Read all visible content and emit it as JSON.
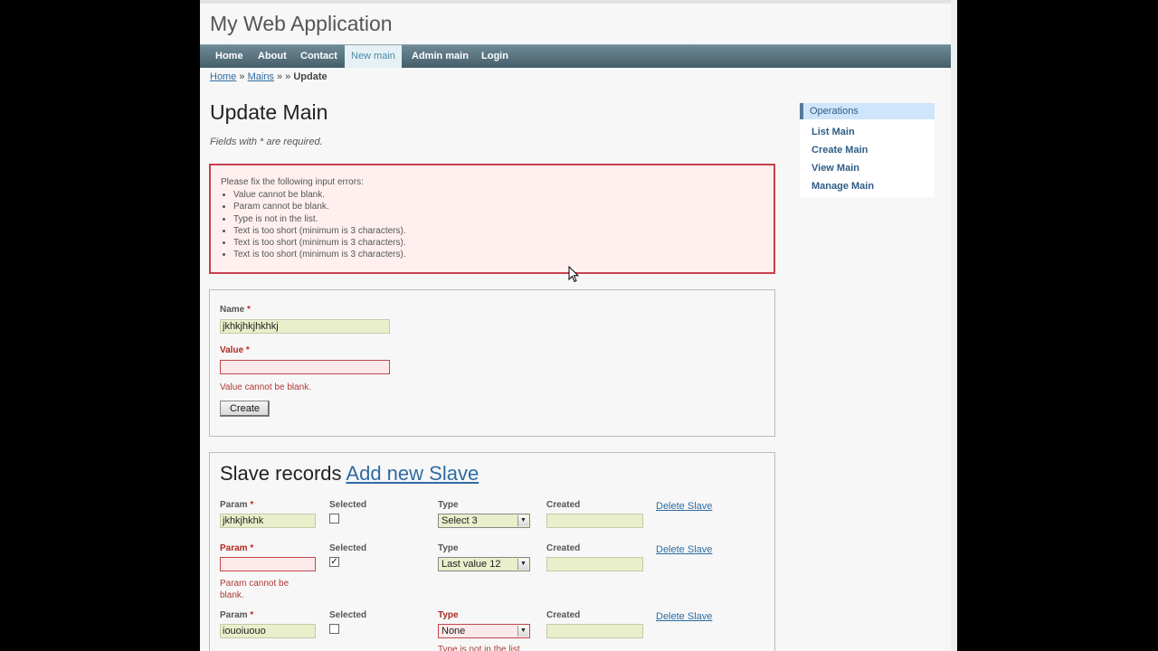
{
  "app": {
    "title": "My Web Application"
  },
  "menu": {
    "items": [
      {
        "label": "Home"
      },
      {
        "label": "About"
      },
      {
        "label": "Contact"
      },
      {
        "label": "New main"
      },
      {
        "label": "Admin main"
      },
      {
        "label": "Login"
      }
    ],
    "active": "New main"
  },
  "breadcrumb": {
    "home": "Home",
    "sep1": "»",
    "mains": "Mains",
    "sep2": "» »",
    "current": "Update"
  },
  "heading": "Update Main",
  "note": "Fields with * are required.",
  "error_summary": {
    "title": "Please fix the following input errors:",
    "errors": [
      "Value cannot be blank.",
      "Param cannot be blank.",
      "Type is not in the list.",
      "Text is too short (minimum is 3 characters).",
      "Text is too short (minimum is 3 characters).",
      "Text is too short (minimum is 3 characters)."
    ]
  },
  "form": {
    "name_label": "Name",
    "name_value": "jkhkjhkjhkhkj",
    "value_label": "Value",
    "value_value": "",
    "value_error": "Value cannot be blank.",
    "required_mark": "*",
    "create_button": "Create"
  },
  "slaves": {
    "heading": "Slave records",
    "add_link": "Add new Slave",
    "rows": [
      {
        "param_label": "Param",
        "param_value": "jkhkjhkhk",
        "param_error": "",
        "selected_label": "Selected",
        "selected": false,
        "type_label": "Type",
        "type_value": "Select 3",
        "type_error": "",
        "created_label": "Created",
        "created_value": "",
        "delete": "Delete Slave"
      },
      {
        "param_label": "Param",
        "param_value": "",
        "param_error": "Param cannot be blank.",
        "selected_label": "Selected",
        "selected": true,
        "type_label": "Type",
        "type_value": "Last value 12",
        "type_error": "",
        "created_label": "Created",
        "created_value": "",
        "delete": "Delete Slave"
      },
      {
        "param_label": "Param",
        "param_value": "iouoiuouo",
        "param_error": "",
        "selected_label": "Selected",
        "selected": false,
        "type_label": "Type",
        "type_value": "None",
        "type_error": "Type is not in the list.",
        "created_label": "Created",
        "created_value": "",
        "delete": "Delete Slave"
      }
    ]
  },
  "sidebar": {
    "title": "Operations",
    "items": [
      {
        "label": "List Main"
      },
      {
        "label": "Create Main"
      },
      {
        "label": "View Main"
      },
      {
        "label": "Manage Main"
      }
    ]
  },
  "icons": {
    "checkbox_checked": "✓",
    "dropdown_arrow": "▼"
  },
  "colors": {
    "menu_bar": "#455f6a",
    "error_border": "#c6404c",
    "field_bg": "#e9efcb",
    "link": "#2e6ca3"
  }
}
